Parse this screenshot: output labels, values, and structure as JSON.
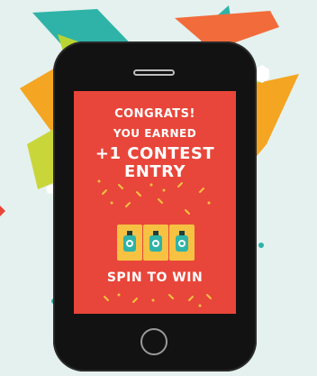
{
  "screen": {
    "line1": "CONGRATS!",
    "line2": "YOU EARNED",
    "line3": "+1 CONTEST",
    "line4": "ENTRY",
    "button": "SPIN TO WIN"
  },
  "slots": [
    {
      "icon": "bottle-icon"
    },
    {
      "icon": "bottle-icon"
    },
    {
      "icon": "bottle-icon"
    }
  ],
  "colors": {
    "background": "#e5f1ee",
    "screen": "#e8463a",
    "phone": "#121212",
    "slot": "#f7c242",
    "teal": "#2fb3a8",
    "lime": "#b9d533",
    "orange": "#f4a521",
    "yellow": "#f7c242"
  }
}
